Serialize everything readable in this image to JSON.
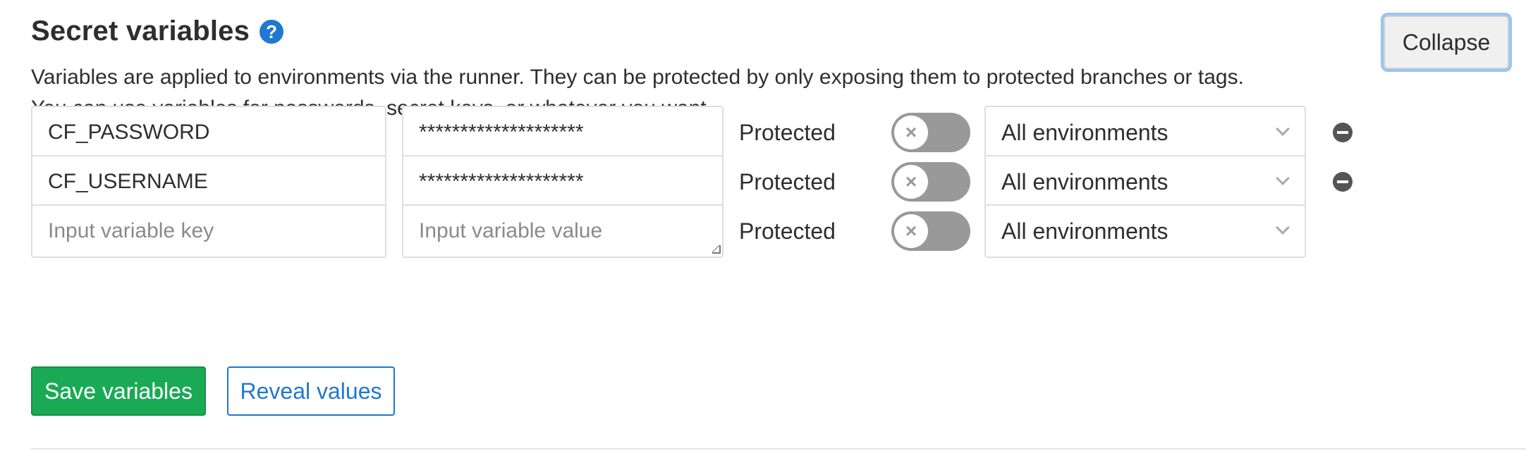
{
  "section": {
    "title": "Secret variables",
    "help_icon": "question-circle-icon",
    "collapse_label": "Collapse",
    "description_line1": "Variables are applied to environments via the runner. They can be protected by only exposing them to protected branches or tags.",
    "description_line2": "You can use variables for passwords, secret keys, or whatever you want."
  },
  "variables": [
    {
      "key": "CF_PASSWORD",
      "value": "********************",
      "protected_label": "Protected",
      "protected": false,
      "environment": "All environments"
    },
    {
      "key": "CF_USERNAME",
      "value": "********************",
      "protected_label": "Protected",
      "protected": false,
      "environment": "All environments"
    },
    {
      "key": "",
      "key_placeholder": "Input variable key",
      "value": "",
      "value_placeholder": "Input variable value",
      "protected_label": "Protected",
      "protected": false,
      "environment": "All environments"
    }
  ],
  "toggle_off_glyph": "×",
  "actions": {
    "save_label": "Save variables",
    "reveal_label": "Reveal values"
  },
  "colors": {
    "primary_blue": "#1f78d1",
    "save_green": "#1aaa55",
    "toggle_off": "#999999"
  }
}
